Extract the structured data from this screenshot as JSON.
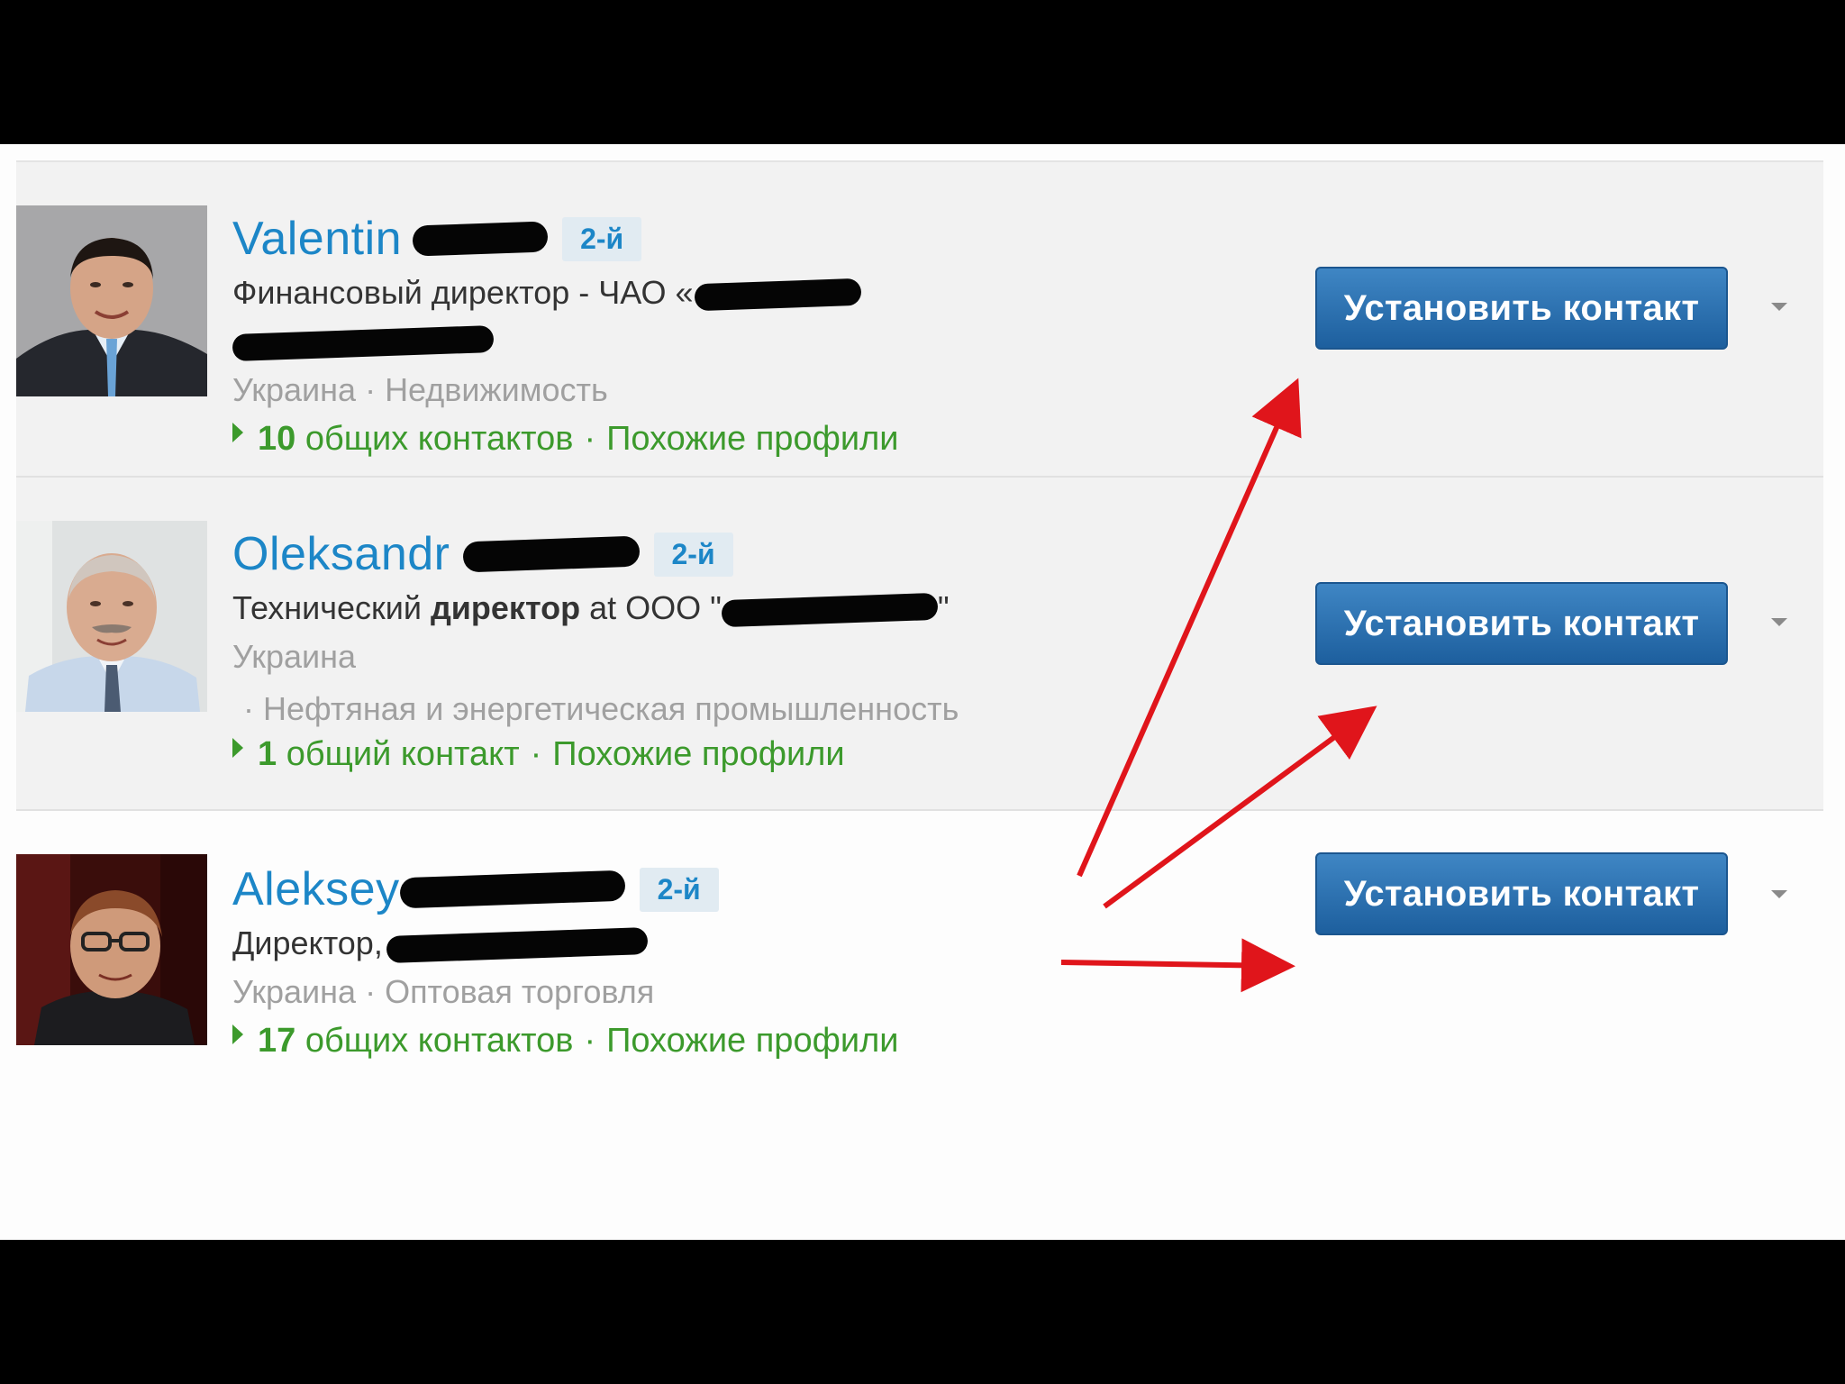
{
  "connect_label": "Установить контакт",
  "people": [
    {
      "first_name": "Valentin",
      "degree": "2-й",
      "headline_prefix": "Финансовый директор - ЧАО «",
      "location": "Украина",
      "industry": "Недвижимость",
      "shared_count": "10",
      "shared_label": "общих контактов",
      "similar": "Похожие профили"
    },
    {
      "first_name": "Oleksandr",
      "degree": "2-й",
      "headline_pre": "Технический ",
      "headline_bold": "директор",
      "headline_post": " at ООО \"",
      "headline_close": "\"",
      "location": "Украина",
      "industry": "Нефтяная и энергетическая промышленность",
      "shared_count": "1",
      "shared_label": "общий контакт",
      "similar": "Похожие профили"
    },
    {
      "first_name": "Aleksey",
      "degree": "2-й",
      "headline_prefix": "Директор,",
      "location": "Украина",
      "industry": "Оптовая торговля",
      "shared_count": "17",
      "shared_label": "общих контактов",
      "similar": "Похожие профили"
    }
  ],
  "colors": {
    "name": "#1c86c7",
    "green": "#3c9a2c",
    "button": "#2a6fb0",
    "arrow": "#e0151b"
  }
}
